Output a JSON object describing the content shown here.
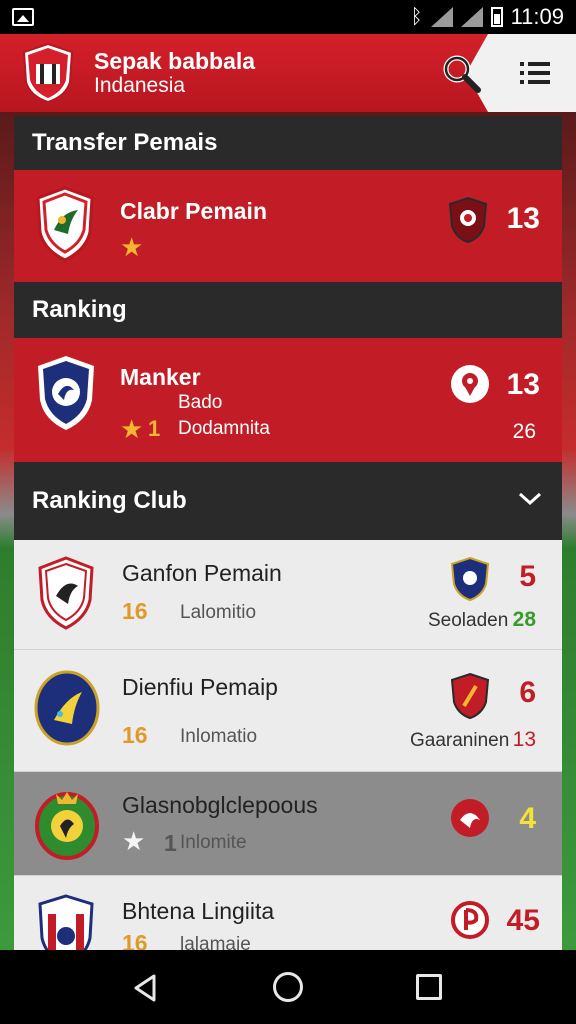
{
  "status_bar": {
    "time": "11:09"
  },
  "header": {
    "title": "Sepak babbala",
    "subtitle": "Indanesia"
  },
  "transfer": {
    "section_title": "Transfer Pemais",
    "title": "Clabr Pemain",
    "count": "13"
  },
  "ranking": {
    "section_title": "Ranking",
    "name": "Manker",
    "sub": "Bado",
    "rank": "1",
    "desc": "Dodamnita",
    "value1": "13",
    "value2": "26"
  },
  "ranking_club": {
    "section_title": "Ranking Club",
    "rows": [
      {
        "title": "Ganfon Pemain",
        "number": "16",
        "desc": "Lalomitio",
        "right_label": "Seoladen",
        "right_small": "28",
        "right_big": "5"
      },
      {
        "title": "Dienfiu Pemaip",
        "number": "16",
        "desc": "Inlomatio",
        "right_label": "Gaaraninen",
        "right_small": "13",
        "right_big": "6"
      },
      {
        "title": "Glasnobglclepoous",
        "number": "1",
        "desc": "Inlomite",
        "right_big": "4"
      },
      {
        "title": "Bhtena Lingiita",
        "number": "16",
        "desc": "lalamaie",
        "right_big": "45"
      }
    ]
  }
}
